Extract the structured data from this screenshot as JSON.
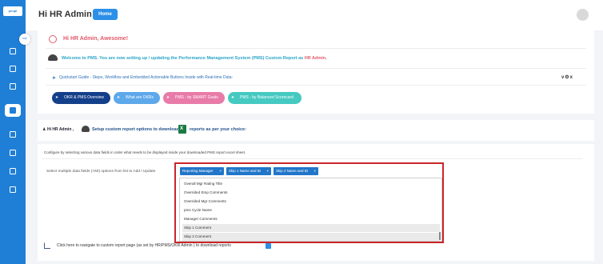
{
  "brand": {
    "logo_text": "peopl"
  },
  "sidebar": {
    "toggle_icon": "arrow-icon",
    "items": [
      {
        "icon": "dashboard-icon"
      },
      {
        "icon": "calendar-icon"
      },
      {
        "icon": "users-icon"
      },
      {
        "icon": "report-icon",
        "active": true
      },
      {
        "icon": "document-icon"
      },
      {
        "icon": "link-icon"
      },
      {
        "icon": "list-icon"
      },
      {
        "icon": "file-icon"
      }
    ]
  },
  "header": {
    "title": "Hi HR Admin",
    "home_label": "Home"
  },
  "intro": {
    "greeting": "Hi HR Admin, Awesome!",
    "welcome_text": "Welcome to PMS. You are now setting up / updating the Performance Management System (PMS) Custom Report as",
    "welcome_role": "HR Admin.",
    "quickstart": "Quickstart Guide - Steps, Workflow and Embedded Actionable Buttons Inside with Real-time Data:",
    "quickstart_controls": "v⚙x",
    "buttons": [
      {
        "label": "OKR & PMS Overview",
        "color": "#143f8a"
      },
      {
        "label": "What are OKRs",
        "color": "#5da8ea"
      },
      {
        "label": "PMS - by SMART Goals",
        "color": "#e87ba8"
      },
      {
        "label": "PMS - by Balanced Scorecard",
        "color": "#45c9c1"
      }
    ]
  },
  "setup": {
    "hi": "Hi HR Admin ,",
    "text1": "Setup custom report options to download",
    "text2": "reports as per your choice:"
  },
  "config": {
    "description": "Configure by selecting various data fields in order what needs to be displayed inside your downloaded PMS report excel sheet.",
    "select_label": "Select multiple data fields (>50) options from list to Add / Update",
    "selected_tags": [
      {
        "label": "Reporting Manager",
        "remove": "×"
      },
      {
        "label": "Skip 1 Name and ID",
        "remove": "×"
      },
      {
        "label": "Skip 2 Name and ID",
        "remove": "×"
      }
    ],
    "options": [
      "Overall Mgr Rating Title",
      "Overrided Emp Comments",
      "Overrided Mgr Comments",
      "pms Cycle Name",
      "Manager Comments",
      "Skip 1 Comment",
      "Skip 2 Comment"
    ],
    "nav_link": "Click here to navigate to custom report page (as set by HR/PMS/OKR Admin ) to download reports"
  }
}
